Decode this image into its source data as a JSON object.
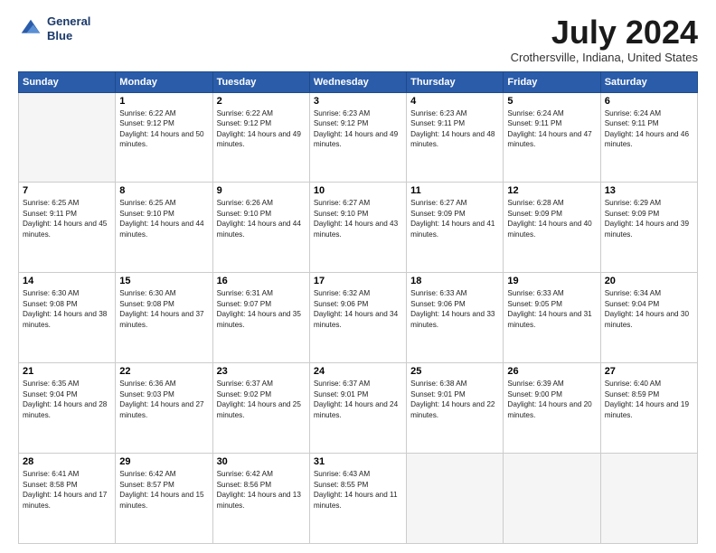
{
  "logo": {
    "line1": "General",
    "line2": "Blue"
  },
  "title": "July 2024",
  "subtitle": "Crothersville, Indiana, United States",
  "days_of_week": [
    "Sunday",
    "Monday",
    "Tuesday",
    "Wednesday",
    "Thursday",
    "Friday",
    "Saturday"
  ],
  "weeks": [
    [
      {
        "day": "",
        "empty": true
      },
      {
        "day": "1",
        "sunrise": "Sunrise: 6:22 AM",
        "sunset": "Sunset: 9:12 PM",
        "daylight": "Daylight: 14 hours and 50 minutes."
      },
      {
        "day": "2",
        "sunrise": "Sunrise: 6:22 AM",
        "sunset": "Sunset: 9:12 PM",
        "daylight": "Daylight: 14 hours and 49 minutes."
      },
      {
        "day": "3",
        "sunrise": "Sunrise: 6:23 AM",
        "sunset": "Sunset: 9:12 PM",
        "daylight": "Daylight: 14 hours and 49 minutes."
      },
      {
        "day": "4",
        "sunrise": "Sunrise: 6:23 AM",
        "sunset": "Sunset: 9:11 PM",
        "daylight": "Daylight: 14 hours and 48 minutes."
      },
      {
        "day": "5",
        "sunrise": "Sunrise: 6:24 AM",
        "sunset": "Sunset: 9:11 PM",
        "daylight": "Daylight: 14 hours and 47 minutes."
      },
      {
        "day": "6",
        "sunrise": "Sunrise: 6:24 AM",
        "sunset": "Sunset: 9:11 PM",
        "daylight": "Daylight: 14 hours and 46 minutes."
      }
    ],
    [
      {
        "day": "7",
        "sunrise": "Sunrise: 6:25 AM",
        "sunset": "Sunset: 9:11 PM",
        "daylight": "Daylight: 14 hours and 45 minutes."
      },
      {
        "day": "8",
        "sunrise": "Sunrise: 6:25 AM",
        "sunset": "Sunset: 9:10 PM",
        "daylight": "Daylight: 14 hours and 44 minutes."
      },
      {
        "day": "9",
        "sunrise": "Sunrise: 6:26 AM",
        "sunset": "Sunset: 9:10 PM",
        "daylight": "Daylight: 14 hours and 44 minutes."
      },
      {
        "day": "10",
        "sunrise": "Sunrise: 6:27 AM",
        "sunset": "Sunset: 9:10 PM",
        "daylight": "Daylight: 14 hours and 43 minutes."
      },
      {
        "day": "11",
        "sunrise": "Sunrise: 6:27 AM",
        "sunset": "Sunset: 9:09 PM",
        "daylight": "Daylight: 14 hours and 41 minutes."
      },
      {
        "day": "12",
        "sunrise": "Sunrise: 6:28 AM",
        "sunset": "Sunset: 9:09 PM",
        "daylight": "Daylight: 14 hours and 40 minutes."
      },
      {
        "day": "13",
        "sunrise": "Sunrise: 6:29 AM",
        "sunset": "Sunset: 9:09 PM",
        "daylight": "Daylight: 14 hours and 39 minutes."
      }
    ],
    [
      {
        "day": "14",
        "sunrise": "Sunrise: 6:30 AM",
        "sunset": "Sunset: 9:08 PM",
        "daylight": "Daylight: 14 hours and 38 minutes."
      },
      {
        "day": "15",
        "sunrise": "Sunrise: 6:30 AM",
        "sunset": "Sunset: 9:08 PM",
        "daylight": "Daylight: 14 hours and 37 minutes."
      },
      {
        "day": "16",
        "sunrise": "Sunrise: 6:31 AM",
        "sunset": "Sunset: 9:07 PM",
        "daylight": "Daylight: 14 hours and 35 minutes."
      },
      {
        "day": "17",
        "sunrise": "Sunrise: 6:32 AM",
        "sunset": "Sunset: 9:06 PM",
        "daylight": "Daylight: 14 hours and 34 minutes."
      },
      {
        "day": "18",
        "sunrise": "Sunrise: 6:33 AM",
        "sunset": "Sunset: 9:06 PM",
        "daylight": "Daylight: 14 hours and 33 minutes."
      },
      {
        "day": "19",
        "sunrise": "Sunrise: 6:33 AM",
        "sunset": "Sunset: 9:05 PM",
        "daylight": "Daylight: 14 hours and 31 minutes."
      },
      {
        "day": "20",
        "sunrise": "Sunrise: 6:34 AM",
        "sunset": "Sunset: 9:04 PM",
        "daylight": "Daylight: 14 hours and 30 minutes."
      }
    ],
    [
      {
        "day": "21",
        "sunrise": "Sunrise: 6:35 AM",
        "sunset": "Sunset: 9:04 PM",
        "daylight": "Daylight: 14 hours and 28 minutes."
      },
      {
        "day": "22",
        "sunrise": "Sunrise: 6:36 AM",
        "sunset": "Sunset: 9:03 PM",
        "daylight": "Daylight: 14 hours and 27 minutes."
      },
      {
        "day": "23",
        "sunrise": "Sunrise: 6:37 AM",
        "sunset": "Sunset: 9:02 PM",
        "daylight": "Daylight: 14 hours and 25 minutes."
      },
      {
        "day": "24",
        "sunrise": "Sunrise: 6:37 AM",
        "sunset": "Sunset: 9:01 PM",
        "daylight": "Daylight: 14 hours and 24 minutes."
      },
      {
        "day": "25",
        "sunrise": "Sunrise: 6:38 AM",
        "sunset": "Sunset: 9:01 PM",
        "daylight": "Daylight: 14 hours and 22 minutes."
      },
      {
        "day": "26",
        "sunrise": "Sunrise: 6:39 AM",
        "sunset": "Sunset: 9:00 PM",
        "daylight": "Daylight: 14 hours and 20 minutes."
      },
      {
        "day": "27",
        "sunrise": "Sunrise: 6:40 AM",
        "sunset": "Sunset: 8:59 PM",
        "daylight": "Daylight: 14 hours and 19 minutes."
      }
    ],
    [
      {
        "day": "28",
        "sunrise": "Sunrise: 6:41 AM",
        "sunset": "Sunset: 8:58 PM",
        "daylight": "Daylight: 14 hours and 17 minutes."
      },
      {
        "day": "29",
        "sunrise": "Sunrise: 6:42 AM",
        "sunset": "Sunset: 8:57 PM",
        "daylight": "Daylight: 14 hours and 15 minutes."
      },
      {
        "day": "30",
        "sunrise": "Sunrise: 6:42 AM",
        "sunset": "Sunset: 8:56 PM",
        "daylight": "Daylight: 14 hours and 13 minutes."
      },
      {
        "day": "31",
        "sunrise": "Sunrise: 6:43 AM",
        "sunset": "Sunset: 8:55 PM",
        "daylight": "Daylight: 14 hours and 11 minutes."
      },
      {
        "day": "",
        "empty": true
      },
      {
        "day": "",
        "empty": true
      },
      {
        "day": "",
        "empty": true
      }
    ]
  ]
}
